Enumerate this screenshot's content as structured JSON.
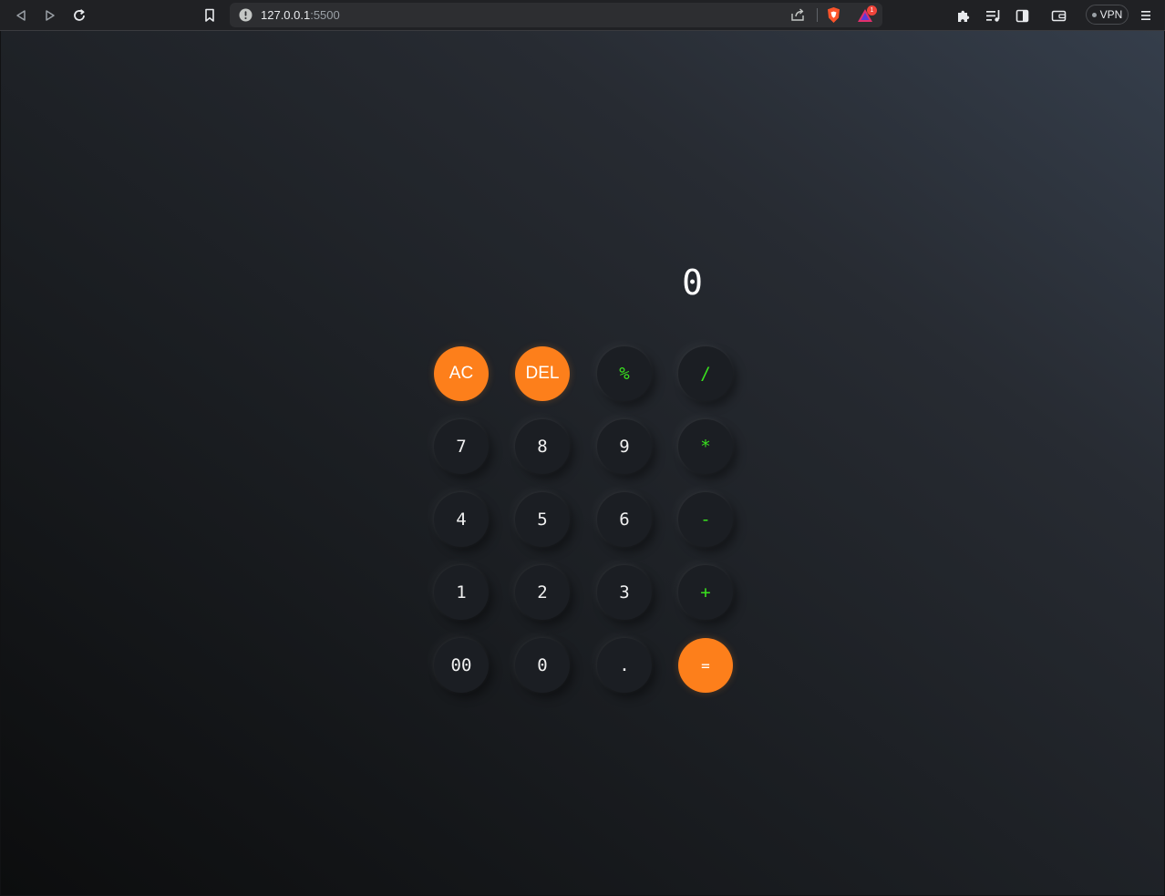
{
  "browser": {
    "url_host": "127.0.0.1",
    "url_port": ":5500",
    "notification_count": "1",
    "vpn_label": "VPN",
    "icons": [
      "back-icon",
      "forward-icon",
      "reload-icon",
      "bookmark-icon",
      "site-info-icon",
      "share-icon",
      "brave-shields-icon",
      "brave-rewards-icon",
      "extensions-icon",
      "playlist-icon",
      "sidebar-icon",
      "wallet-icon",
      "menu-icon"
    ]
  },
  "calculator": {
    "display": "0",
    "colors": {
      "accent": "#fd7f1b",
      "operator": "#39e11e",
      "key_bg": "#1b1e23",
      "digit_text": "#f0f0f0"
    },
    "keys": {
      "ac": "AC",
      "del": "DEL",
      "percent": "%",
      "divide": "/",
      "seven": "7",
      "eight": "8",
      "nine": "9",
      "multiply": "*",
      "four": "4",
      "five": "5",
      "six": "6",
      "minus": "-",
      "one": "1",
      "two": "2",
      "three": "3",
      "plus": "+",
      "double_zero": "00",
      "zero": "0",
      "decimal": ".",
      "equals": "="
    }
  }
}
